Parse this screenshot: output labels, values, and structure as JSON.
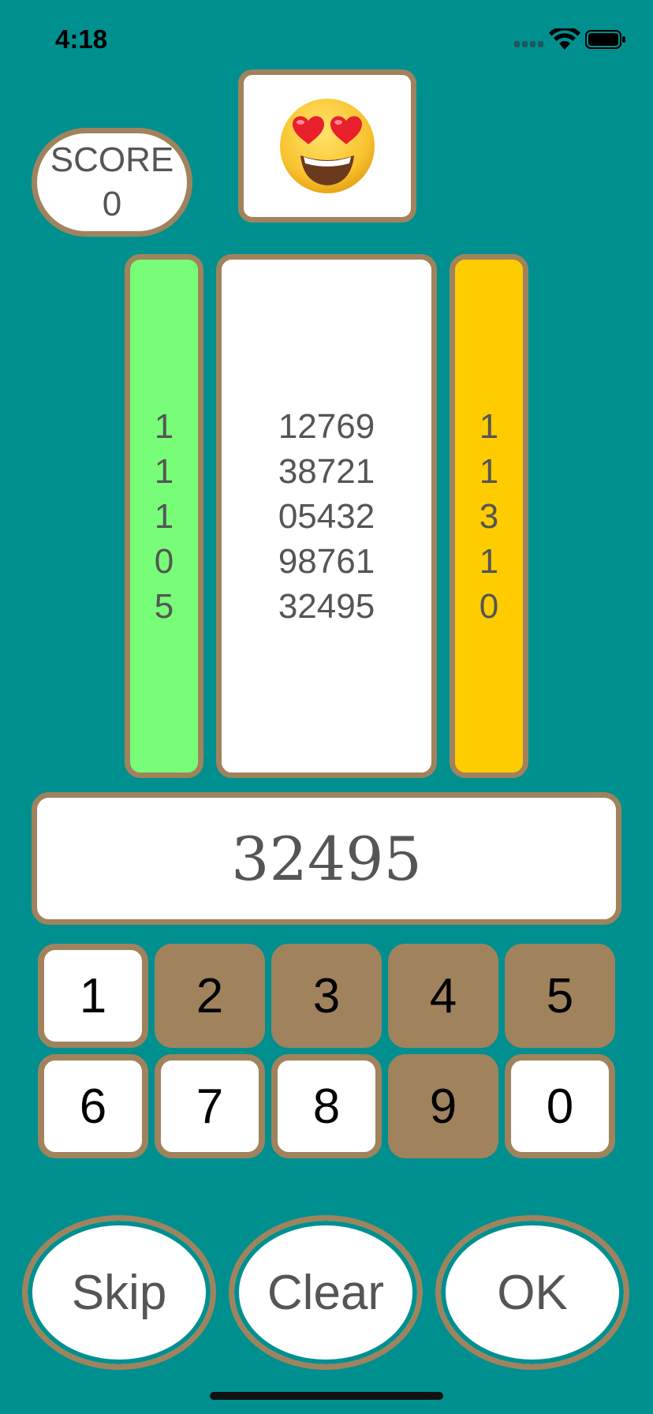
{
  "status_bar": {
    "time": "4:18"
  },
  "score": {
    "label": "SCORE",
    "value": "0"
  },
  "emoji": {
    "icon": "heart-eyes-emoji-icon"
  },
  "left_column": {
    "values": [
      "1",
      "1",
      "1",
      "0",
      "5"
    ],
    "color": "#77fd77"
  },
  "history": {
    "rows": [
      "12769",
      "38721",
      "05432",
      "98761",
      "32495"
    ]
  },
  "right_column": {
    "values": [
      "1",
      "1",
      "3",
      "1",
      "0"
    ],
    "color": "#ffcc00"
  },
  "answer": {
    "value": "32495"
  },
  "keypad": {
    "keys": [
      {
        "label": "1",
        "enabled": true
      },
      {
        "label": "2",
        "enabled": false
      },
      {
        "label": "3",
        "enabled": false
      },
      {
        "label": "4",
        "enabled": false
      },
      {
        "label": "5",
        "enabled": false
      },
      {
        "label": "6",
        "enabled": true
      },
      {
        "label": "7",
        "enabled": true
      },
      {
        "label": "8",
        "enabled": true
      },
      {
        "label": "9",
        "enabled": false
      },
      {
        "label": "0",
        "enabled": true
      }
    ]
  },
  "actions": {
    "skip": "Skip",
    "clear": "Clear",
    "ok": "OK"
  },
  "colors": {
    "background": "#008f8f",
    "border": "#a0835d",
    "used_key": "#a0835d"
  }
}
